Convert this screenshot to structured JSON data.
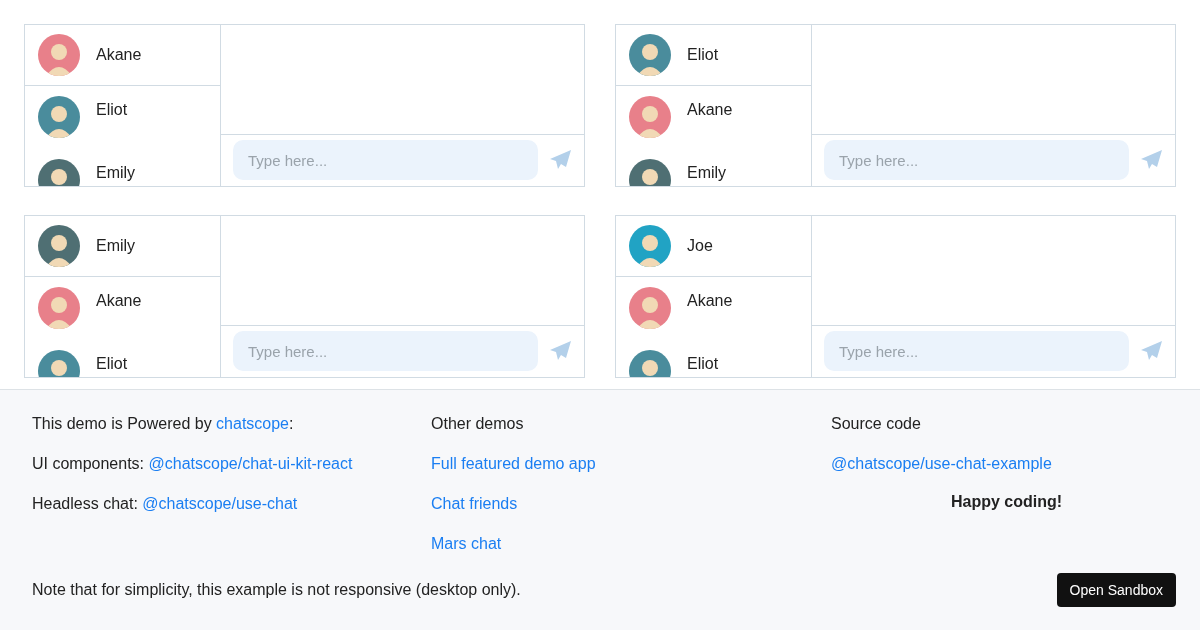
{
  "chats": [
    {
      "contacts": [
        {
          "name": "Akane",
          "color": "#e8808a"
        },
        {
          "name": "Eliot",
          "color": "#4a8c9c"
        },
        {
          "name": "Emily",
          "color": "#4f6f73"
        }
      ],
      "input": {
        "placeholder": "Type here..."
      }
    },
    {
      "contacts": [
        {
          "name": "Eliot",
          "color": "#4a8c9c"
        },
        {
          "name": "Akane",
          "color": "#e8808a"
        },
        {
          "name": "Emily",
          "color": "#4f6f73"
        }
      ],
      "input": {
        "placeholder": "Type here..."
      }
    },
    {
      "contacts": [
        {
          "name": "Emily",
          "color": "#4f6f73"
        },
        {
          "name": "Akane",
          "color": "#e8808a"
        },
        {
          "name": "Eliot",
          "color": "#4a8c9c"
        }
      ],
      "input": {
        "placeholder": "Type here..."
      }
    },
    {
      "contacts": [
        {
          "name": "Joe",
          "color": "#21a3c4"
        },
        {
          "name": "Akane",
          "color": "#e8808a"
        },
        {
          "name": "Eliot",
          "color": "#4a8c9c"
        }
      ],
      "input": {
        "placeholder": "Type here..."
      }
    }
  ],
  "footer": {
    "columns": [
      {
        "lines": [
          {
            "parts": [
              {
                "kind": "text",
                "text": "This demo is Powered by "
              },
              {
                "kind": "link",
                "text": "chatscope"
              },
              {
                "kind": "text",
                "text": ":"
              }
            ]
          },
          {
            "parts": [
              {
                "kind": "text",
                "text": "UI components: "
              },
              {
                "kind": "link",
                "text": "@chatscope/chat-ui-kit-react"
              }
            ]
          },
          {
            "parts": [
              {
                "kind": "text",
                "text": "Headless chat: "
              },
              {
                "kind": "link",
                "text": "@chatscope/use-chat"
              }
            ]
          }
        ]
      },
      {
        "lines": [
          {
            "parts": [
              {
                "kind": "text",
                "text": "Other demos"
              }
            ]
          },
          {
            "parts": [
              {
                "kind": "link",
                "text": "Full featured demo app"
              }
            ]
          },
          {
            "parts": [
              {
                "kind": "link",
                "text": "Chat friends"
              }
            ]
          },
          {
            "parts": [
              {
                "kind": "link",
                "text": "Mars chat"
              }
            ]
          }
        ]
      },
      {
        "lines": [
          {
            "parts": [
              {
                "kind": "text",
                "text": "Source code"
              }
            ]
          },
          {
            "parts": [
              {
                "kind": "link",
                "text": "@chatscope/use-chat-example"
              }
            ]
          }
        ],
        "tagline": "Happy coding!"
      }
    ],
    "note": "Note that for simplicity, this example is not responsive (desktop only).",
    "button": "Open Sandbox"
  }
}
